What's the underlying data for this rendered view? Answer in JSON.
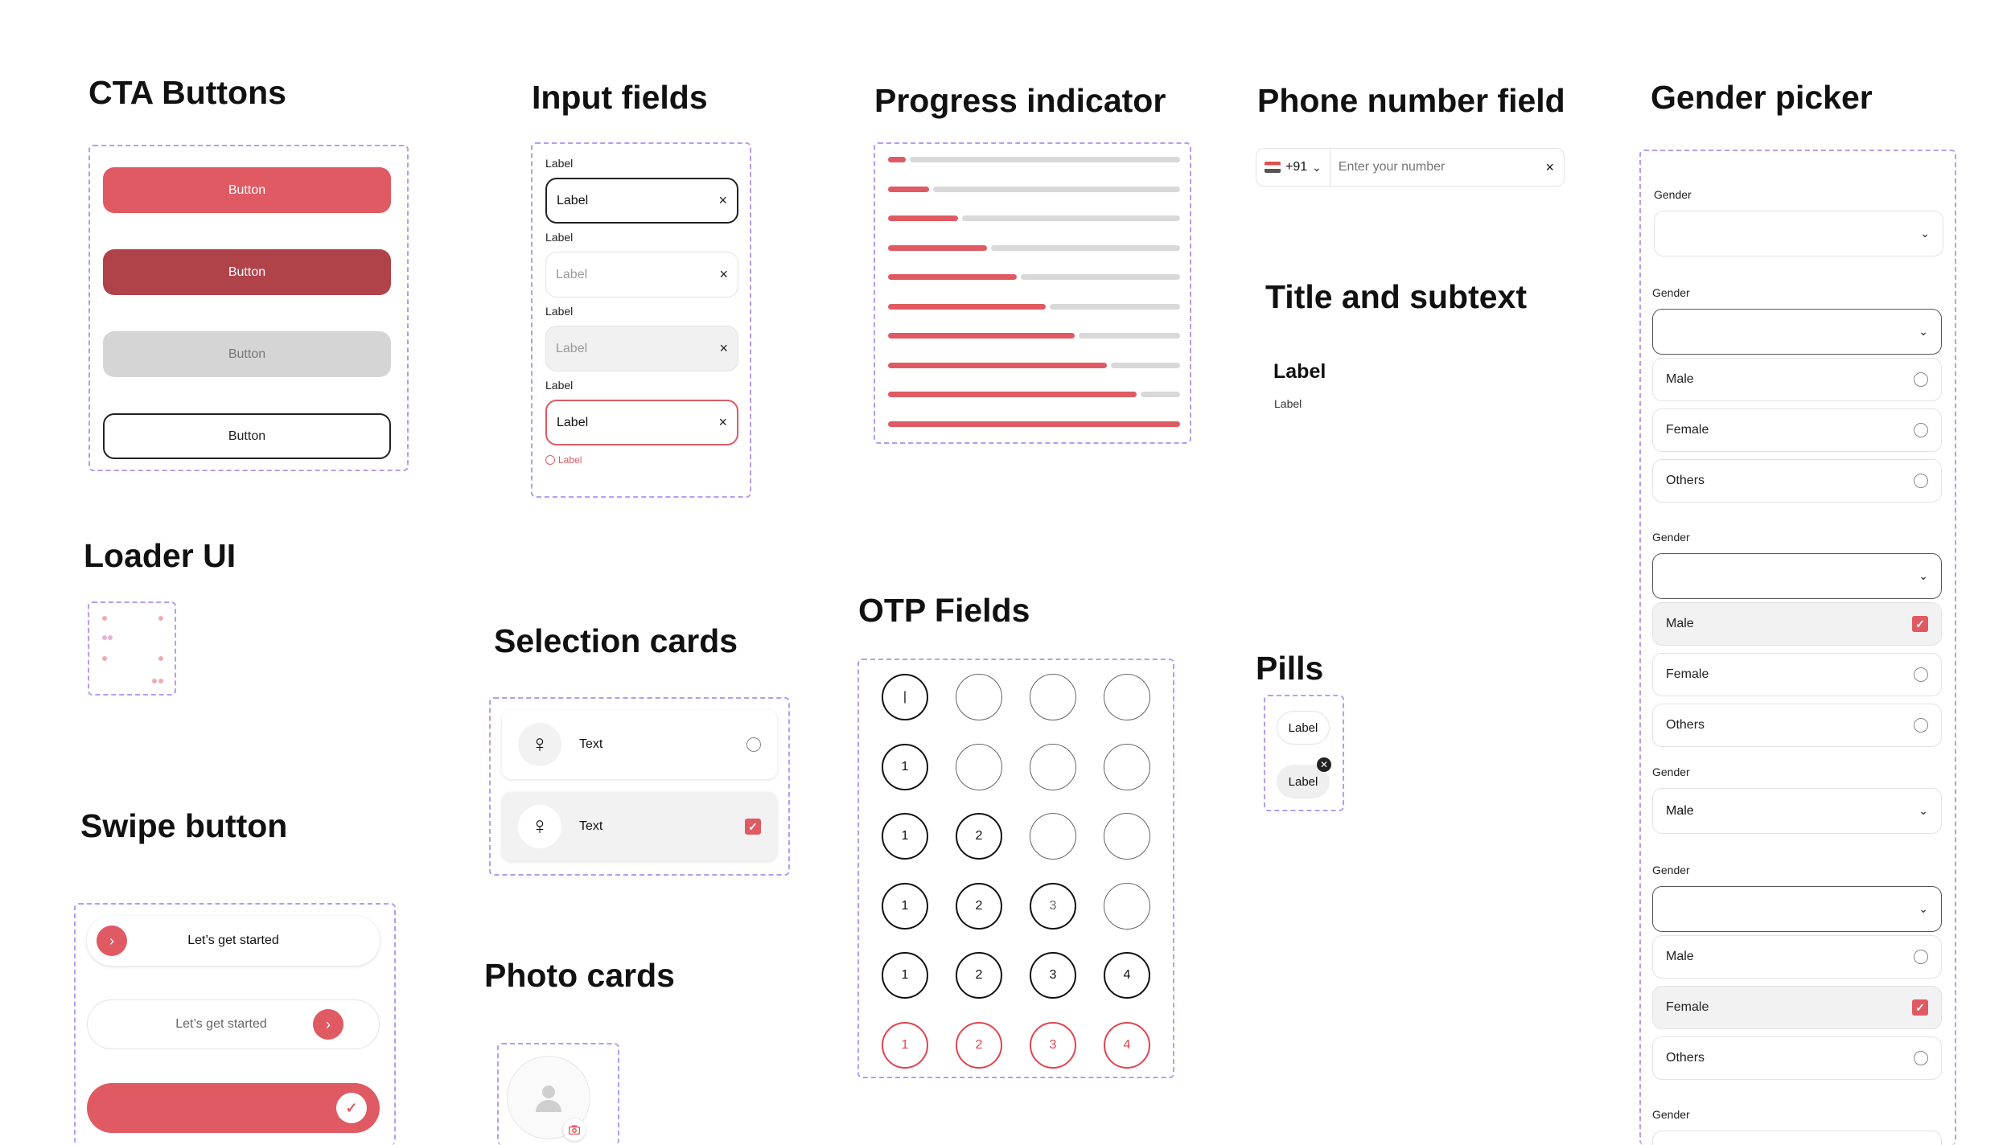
{
  "sections": {
    "cta": "CTA Buttons",
    "input": "Input fields",
    "progress": "Progress indicator",
    "phone": "Phone number field",
    "gender": "Gender picker",
    "title_subtext": "Title and subtext",
    "loader": "Loader UI",
    "selection": "Selection cards",
    "otp": "OTP Fields",
    "pills": "Pills",
    "swipe": "Swipe button",
    "photo": "Photo cards"
  },
  "cta": {
    "primary": "Button",
    "pressed": "Button",
    "disabled": "Button",
    "outline": "Button"
  },
  "input": {
    "fields": [
      {
        "label": "Label",
        "value": "Label",
        "state": "active"
      },
      {
        "label": "Label",
        "value": "Label",
        "state": "empty"
      },
      {
        "label": "Label",
        "value": "Label",
        "state": "disabled"
      },
      {
        "label": "Label",
        "value": "Label",
        "state": "error"
      }
    ],
    "error_text": "Label",
    "clear_icon": "×"
  },
  "progress": {
    "levels": [
      0.06,
      0.14,
      0.24,
      0.34,
      0.44,
      0.54,
      0.64,
      0.75,
      0.85,
      1.0
    ],
    "fill_color": "#df5a62",
    "track_color": "#d9d9d9"
  },
  "phone": {
    "code": "+91",
    "placeholder": "Enter your number",
    "clear_icon": "×"
  },
  "title_subtext": {
    "title": "Label",
    "subtext": "Label"
  },
  "selection": {
    "cards": [
      {
        "text": "Text",
        "selected": false
      },
      {
        "text": "Text",
        "selected": true
      }
    ]
  },
  "otp": {
    "rows": [
      [
        "|",
        "",
        "",
        ""
      ],
      [
        "1",
        "",
        "",
        ""
      ],
      [
        "1",
        "2",
        "",
        ""
      ],
      [
        "1",
        "2",
        "3",
        ""
      ],
      [
        "1",
        "2",
        "3",
        "4"
      ],
      [
        "1",
        "2",
        "3",
        "4"
      ]
    ]
  },
  "pills": {
    "items": [
      "Label",
      "Label"
    ]
  },
  "swipe": {
    "label_1": "Let’s get started",
    "label_2": "Let’s get started"
  },
  "gender": {
    "label": "Gender",
    "options": [
      "Male",
      "Female",
      "Others"
    ],
    "selected_value": "Male"
  },
  "colors": {
    "accent": "#df5a62",
    "accent_dark": "#b0424a",
    "dashed_border": "#b79cf0"
  }
}
